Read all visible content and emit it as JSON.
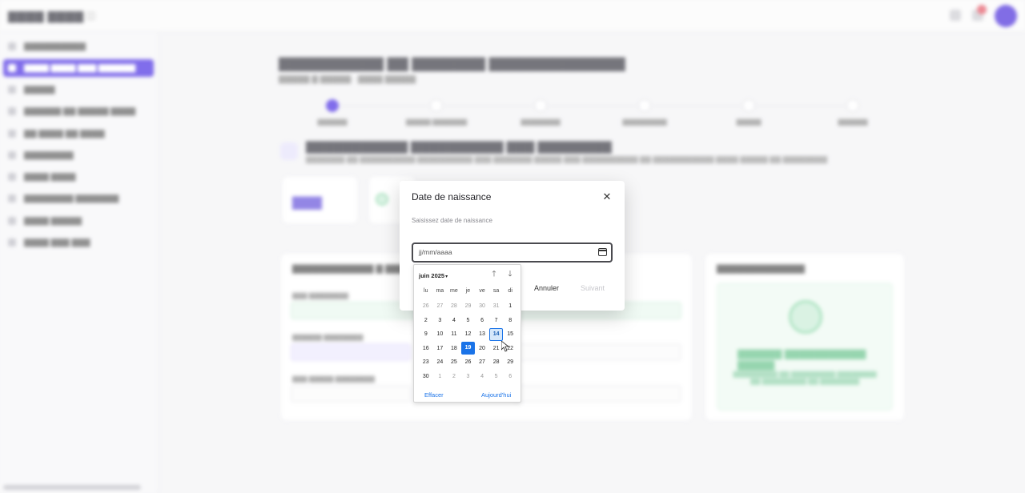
{
  "background": {
    "brand": "",
    "sidebar_count": 10,
    "steps_count": 6
  },
  "dialog": {
    "title": "Date de naissance",
    "help_text": "Saisissez date de naissance",
    "input_placeholder": "jj/mm/aaaa",
    "cancel_label": "Annuler",
    "next_label": "Suivant",
    "close_icon": "close-icon"
  },
  "calendar": {
    "month_label": "juin 2025",
    "weekdays": [
      "lu",
      "ma",
      "me",
      "je",
      "ve",
      "sa",
      "di"
    ],
    "weeks": [
      [
        "26",
        "27",
        "28",
        "29",
        "30",
        "31",
        "1"
      ],
      [
        "2",
        "3",
        "4",
        "5",
        "6",
        "7",
        "8"
      ],
      [
        "9",
        "10",
        "11",
        "12",
        "13",
        "14",
        "15"
      ],
      [
        "16",
        "17",
        "18",
        "19",
        "20",
        "21",
        "22"
      ],
      [
        "23",
        "24",
        "25",
        "26",
        "27",
        "28",
        "29"
      ],
      [
        "30",
        "1",
        "2",
        "3",
        "4",
        "5",
        "6"
      ]
    ],
    "selected_day": "19",
    "hovered_day": "14",
    "clear_label": "Effacer",
    "today_label": "Aujourd'hui"
  },
  "colors": {
    "accent": "#3d1fe0",
    "today_bg": "#1a73e8",
    "link": "#1a73e8"
  }
}
